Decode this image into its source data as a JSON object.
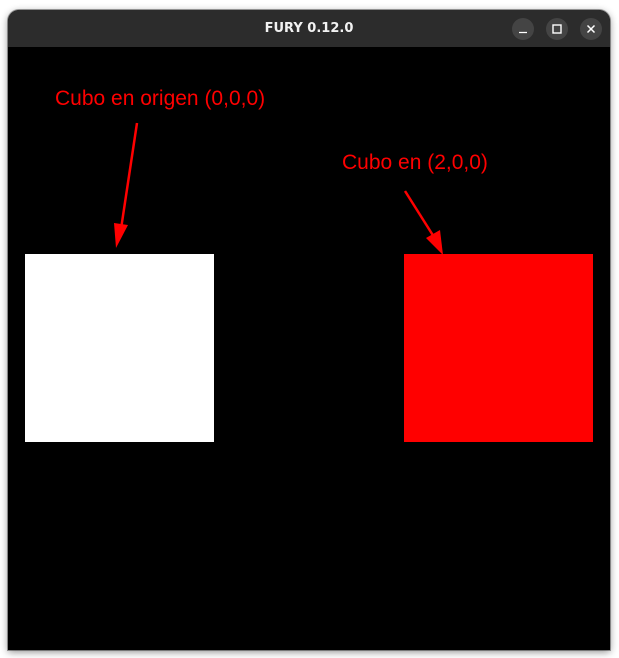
{
  "window": {
    "title": "FURY 0.12.0",
    "controls": {
      "minimize_icon": "minimize-icon",
      "maximize_icon": "maximize-icon",
      "close_icon": "close-icon"
    }
  },
  "scene": {
    "background_color": "#000000",
    "annotation_color": "#ff0000",
    "cubes": [
      {
        "name": "origin-cube",
        "color": "#ffffff"
      },
      {
        "name": "second-cube",
        "color": "#ff0000"
      }
    ],
    "labels": {
      "origin": "Cubo en origen (0,0,0)",
      "second": "Cubo en (2,0,0)"
    }
  }
}
